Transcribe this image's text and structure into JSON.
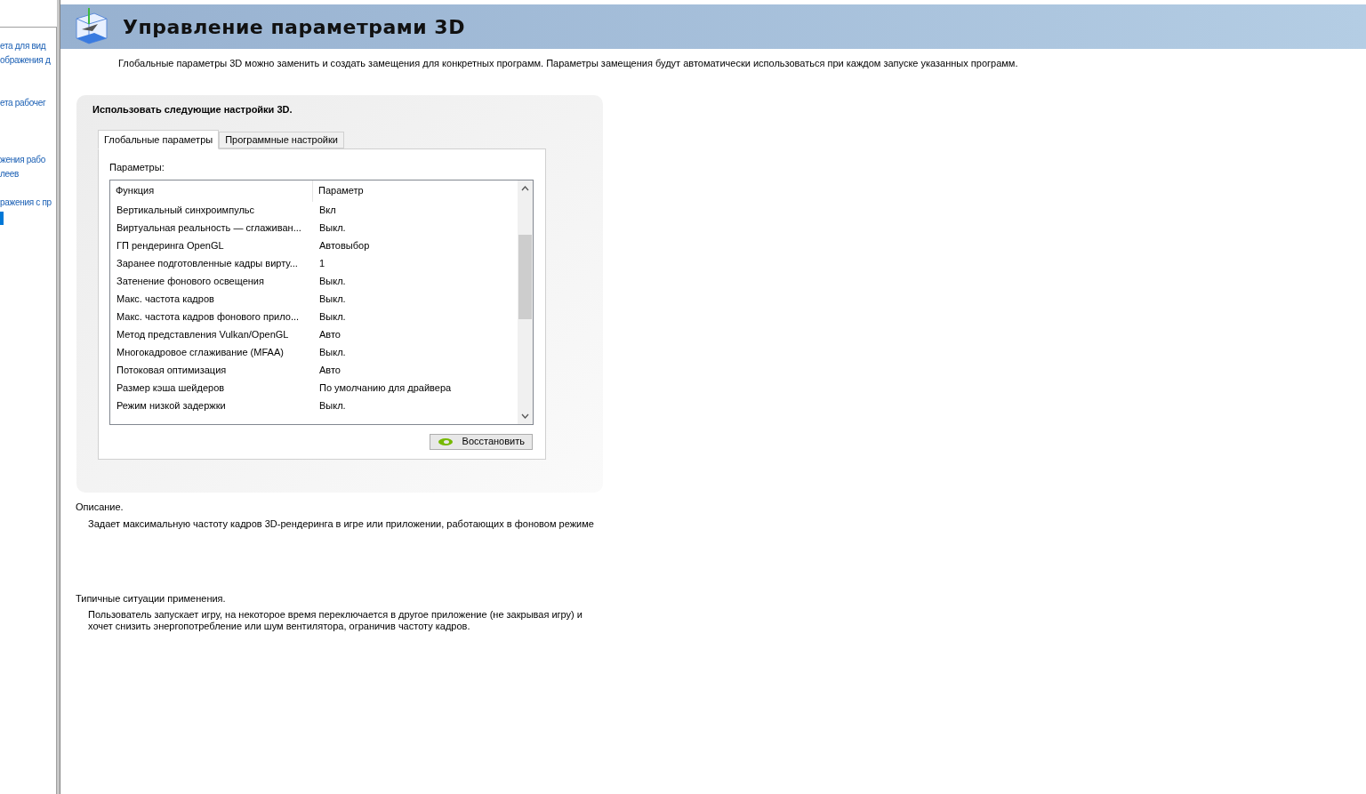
{
  "sidebar": {
    "items": [
      {
        "lines": [
          "ета для вид",
          "ображения д"
        ]
      },
      {
        "lines": [
          "ета рабочег"
        ]
      },
      {
        "lines": [
          "жения рабо",
          "леев"
        ]
      },
      {
        "lines": [
          "ражения с пр"
        ]
      }
    ]
  },
  "header": {
    "title": "Управление параметрами 3D"
  },
  "intro": "Глобальные параметры 3D можно заменить и создать замещения для конкретных программ. Параметры замещения будут автоматически использоваться при каждом запуске указанных программ.",
  "panel": {
    "title": "Использовать следующие настройки 3D.",
    "tabs": [
      {
        "label": "Глобальные параметры",
        "selected": true
      },
      {
        "label": "Программные настройки",
        "selected": false
      }
    ],
    "table_label": "Параметры:",
    "table": {
      "columns": [
        "Функция",
        "Параметр"
      ],
      "rows": [
        [
          "Вертикальный синхроимпульс",
          "Вкл"
        ],
        [
          "Виртуальная реальность — сглаживан...",
          "Выкл."
        ],
        [
          "ГП рендеринга OpenGL",
          "Автовыбор"
        ],
        [
          "Заранее подготовленные кадры вирту...",
          "1"
        ],
        [
          "Затенение фонового освещения",
          "Выкл."
        ],
        [
          "Макс. частота кадров",
          "Выкл."
        ],
        [
          "Макс. частота кадров фонового прило...",
          "Выкл."
        ],
        [
          "Метод представления Vulkan/OpenGL",
          "Авто"
        ],
        [
          "Многокадровое сглаживание (MFAA)",
          "Выкл."
        ],
        [
          "Потоковая оптимизация",
          "Авто"
        ],
        [
          "Размер кэша шейдеров",
          "По умолчанию для драйвера"
        ],
        [
          "Режим низкой задержки",
          "Выкл."
        ]
      ]
    },
    "restore_button": "Восстановить"
  },
  "description": {
    "heading": "Описание.",
    "text": "Задает максимальную частоту кадров 3D-рендеринга в игре или приложении, работающих в фоновом режиме"
  },
  "usage": {
    "heading": "Типичные ситуации применения.",
    "text": "Пользователь запускает игру, на некоторое время переключается в другое приложение (не закрывая игру) и хочет снизить энергопотребление или шум вентилятора, ограничив частоту кадров."
  }
}
